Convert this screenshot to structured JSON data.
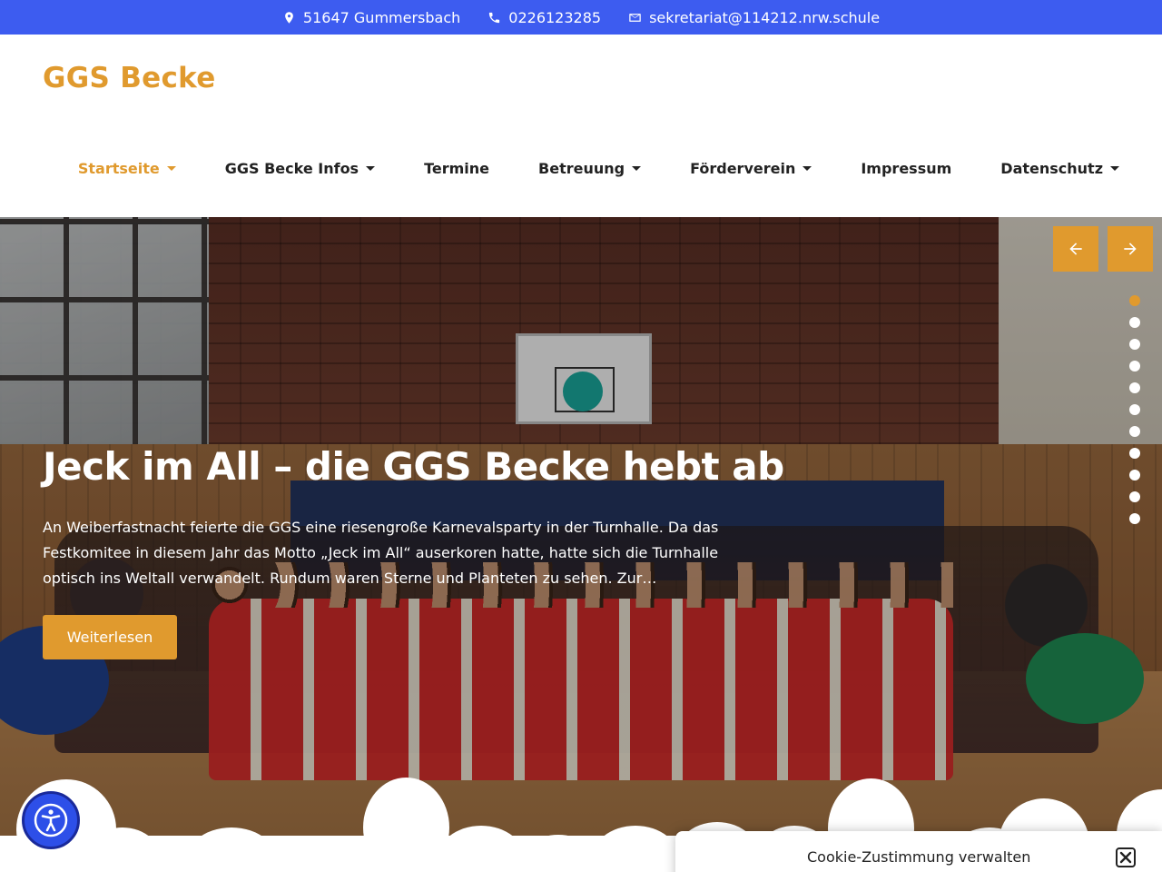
{
  "topbar": {
    "address": "51647 Gummersbach",
    "phone": "0226123285",
    "email": "sekretariat@114212.nrw.schule"
  },
  "header": {
    "logo": "GGS Becke",
    "nav": [
      {
        "label": "Startseite",
        "has_dropdown": true,
        "active": true
      },
      {
        "label": "GGS Becke Infos",
        "has_dropdown": true
      },
      {
        "label": "Termine",
        "has_dropdown": false
      },
      {
        "label": "Betreuung",
        "has_dropdown": true
      },
      {
        "label": "Förderverein",
        "has_dropdown": true
      },
      {
        "label": "Impressum",
        "has_dropdown": false
      },
      {
        "label": "Datenschutz",
        "has_dropdown": true
      }
    ]
  },
  "hero": {
    "title": "Jeck im All – die GGS Becke hebt ab",
    "text": "An Weiberfastnacht feierte die GGS eine riesengroße Karnevalsparty in der Turnhalle. Da das Festkomitee in diesem Jahr das Motto „Jeck im All“ auserkoren hatte, hatte sich die Turnhalle optisch ins Weltall verwandelt. Rundum waren Sterne und Planteten zu sehen. Zur…",
    "button": "Weiterlesen",
    "slide_count": 12,
    "active_slide": 1
  },
  "cookie": {
    "title": "Cookie-Zustimmung verwalten"
  },
  "colors": {
    "topbar": "#3d5cf0",
    "accent": "#e09a2e",
    "accessibility": "#2d4fe8"
  }
}
